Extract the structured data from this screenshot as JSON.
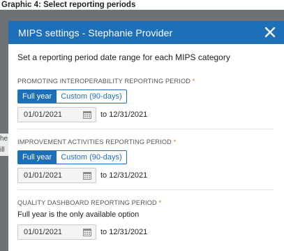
{
  "caption": "Graphic 4: Select reporting periods",
  "background": {
    "fragment_1": "he",
    "fragment_2": "ill"
  },
  "modal": {
    "title": "MIPS settings - Stephanie Provider",
    "intro": "Set a reporting period date range for each MIPS category",
    "sections": [
      {
        "label": "PROMOTING INTEROPERABILITY REPORTING PERIOD",
        "required_marker": "*",
        "full_year_label": "Full year",
        "custom_label": "Custom (90-days)",
        "start_date": "01/01/2021",
        "end_text": "to 12/31/2021"
      },
      {
        "label": "IMPROVEMENT ACTIVITIES REPORTING PERIOD",
        "required_marker": "*",
        "full_year_label": "Full year",
        "custom_label": "Custom (90-days)",
        "start_date": "01/01/2021",
        "end_text": "to 12/31/2021"
      },
      {
        "label": "QUALITY DASHBOARD REPORTING PERIOD",
        "required_marker": "*",
        "note": "Full year is the only available option",
        "start_date": "01/01/2021",
        "end_text": "to 12/31/2021"
      }
    ]
  },
  "colors": {
    "primary": "#1d6fb8",
    "required": "#e0702a",
    "overlay": "#6e7274"
  },
  "icons": {
    "close": "close-icon",
    "calendar": "calendar-icon"
  }
}
